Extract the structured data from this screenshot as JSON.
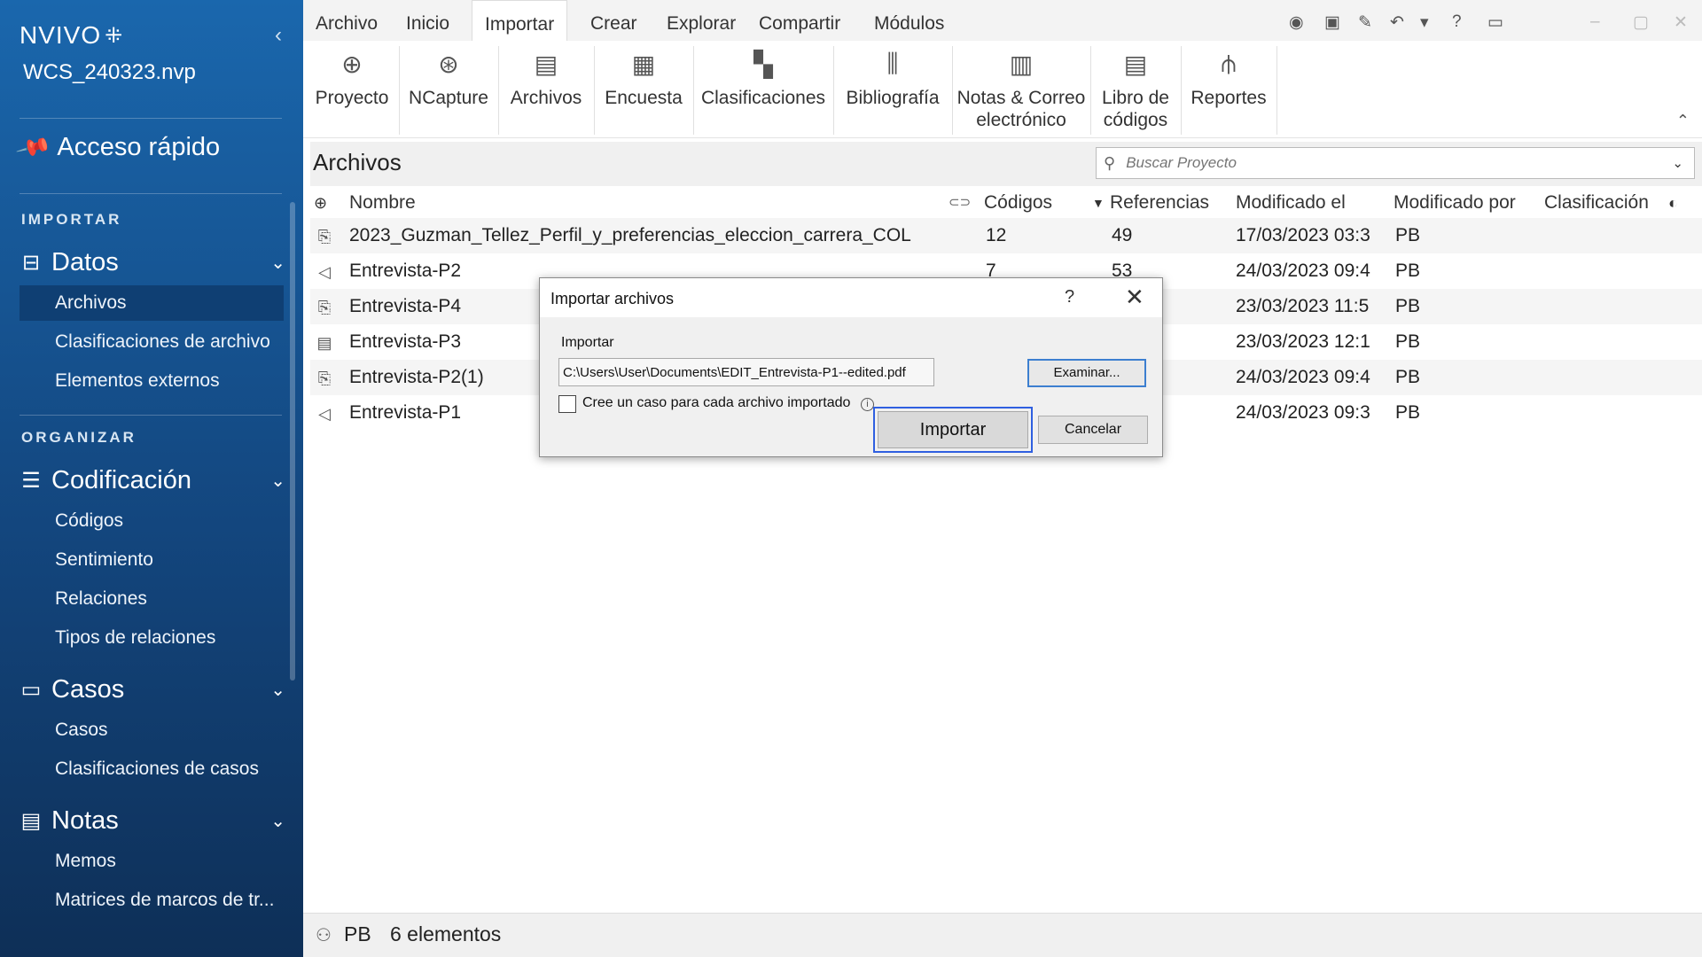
{
  "app": {
    "logo": "NVIVO",
    "logo_mark": "⁜",
    "project_name": "WCS_240323.nvp"
  },
  "sidebar": {
    "quick_access": "Acceso rápido",
    "sections": [
      {
        "title": "IMPORTAR"
      },
      {
        "title": "ORGANIZAR"
      }
    ],
    "groups": {
      "datos": {
        "label": "Datos",
        "items": [
          "Archivos",
          "Clasificaciones de archivo",
          "Elementos externos"
        ]
      },
      "codificacion": {
        "label": "Codificación",
        "items": [
          "Códigos",
          "Sentimiento",
          "Relaciones",
          "Tipos de relaciones"
        ]
      },
      "casos": {
        "label": "Casos",
        "items": [
          "Casos",
          "Clasificaciones de casos"
        ]
      },
      "notas": {
        "label": "Notas",
        "items": [
          "Memos",
          "Matrices de marcos de tr..."
        ]
      }
    }
  },
  "menu": {
    "tabs": [
      "Archivo",
      "Inicio",
      "Importar",
      "Crear",
      "Explorar",
      "Compartir",
      "Módulos"
    ],
    "active": "Importar"
  },
  "ribbon": {
    "buttons": [
      {
        "label": "Proyecto"
      },
      {
        "label": "NCapture"
      },
      {
        "label": "Archivos"
      },
      {
        "label": "Encuesta"
      },
      {
        "label": "Clasificaciones"
      },
      {
        "label": "Bibliografía"
      },
      {
        "label": "Notas & Correo electrónico"
      },
      {
        "label": "Libro de códigos"
      },
      {
        "label": "Reportes"
      }
    ]
  },
  "main": {
    "title": "Archivos",
    "search_placeholder": "Buscar Proyecto",
    "columns": [
      "Nombre",
      "Códigos",
      "Referencias",
      "Modificado el",
      "Modificado por",
      "Clasificación"
    ],
    "rows": [
      {
        "icon": "pdf-icon",
        "name": "2023_Guzman_Tellez_Perfil_y_preferencias_eleccion_carrera_COL",
        "codes": "12",
        "refs": "49",
        "modified": "17/03/2023 03:3",
        "by": "PB"
      },
      {
        "icon": "audio-icon",
        "name": "Entrevista-P2",
        "codes": "7",
        "refs": "53",
        "modified": "24/03/2023 09:4",
        "by": "PB"
      },
      {
        "icon": "pdf-icon",
        "name": "Entrevista-P4",
        "codes": "",
        "refs": "",
        "modified": "23/03/2023 11:5",
        "by": "PB"
      },
      {
        "icon": "document-icon",
        "name": "Entrevista-P3",
        "codes": "",
        "refs": "",
        "modified": "23/03/2023 12:1",
        "by": "PB"
      },
      {
        "icon": "pdf-icon",
        "name": "Entrevista-P2(1)",
        "codes": "",
        "refs": "",
        "modified": "24/03/2023 09:4",
        "by": "PB"
      },
      {
        "icon": "audio-icon",
        "name": "Entrevista-P1",
        "codes": "",
        "refs": "",
        "modified": "24/03/2023 09:3",
        "by": "PB"
      }
    ]
  },
  "status": {
    "user": "PB",
    "count": "6 elementos"
  },
  "dialog": {
    "title": "Importar archivos",
    "help": "?",
    "section_label": "Importar",
    "path": "C:\\Users\\User\\Documents\\EDIT_Entrevista-P1--edited.pdf",
    "browse": "Examinar...",
    "checkbox_label": "Cree un caso para cada archivo importado",
    "import": "Importar",
    "cancel": "Cancelar"
  }
}
